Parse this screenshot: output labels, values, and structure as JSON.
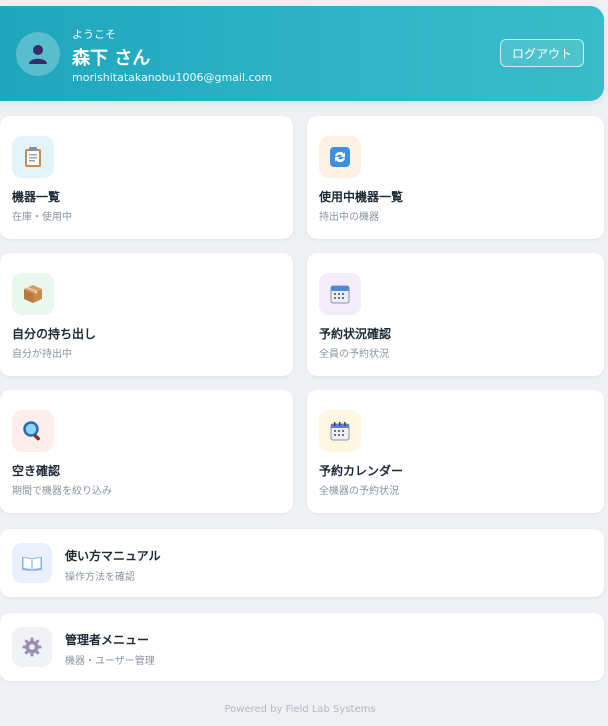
{
  "header": {
    "welcome": "ようこそ",
    "username": "森下 さん",
    "email": "morishitatakanobu1006@gmail.com",
    "logout_label": "ログアウト"
  },
  "menu": [
    {
      "title": "機器一覧",
      "sub": "在庫・使用中",
      "icon": "clipboard-icon",
      "tint": "#e3f4f8"
    },
    {
      "title": "使用中機器一覧",
      "sub": "持出中の機器",
      "icon": "refresh-icon",
      "tint": "#fdf1e3"
    },
    {
      "title": "自分の持ち出し",
      "sub": "自分が持出中",
      "icon": "package-icon",
      "tint": "#e8f8ee"
    },
    {
      "title": "予約状況確認",
      "sub": "全員の予約状況",
      "icon": "calendar-icon",
      "tint": "#f3ecfb"
    },
    {
      "title": "空き確認",
      "sub": "期間で機器を絞り込み",
      "icon": "magnifier-icon",
      "tint": "#fdeeed"
    },
    {
      "title": "予約カレンダー",
      "sub": "全機器の予約状況",
      "icon": "spiral-calendar-icon",
      "tint": "#fdf7e2"
    }
  ],
  "rows": [
    {
      "title": "使い方マニュアル",
      "sub": "操作方法を確認",
      "icon": "book-icon",
      "tint": "#e9f0fb"
    },
    {
      "title": "管理者メニュー",
      "sub": "機器・ユーザー管理",
      "icon": "gear-icon",
      "tint": "#f1f2f5"
    }
  ],
  "footer": "Powered by Field Lab Systems"
}
